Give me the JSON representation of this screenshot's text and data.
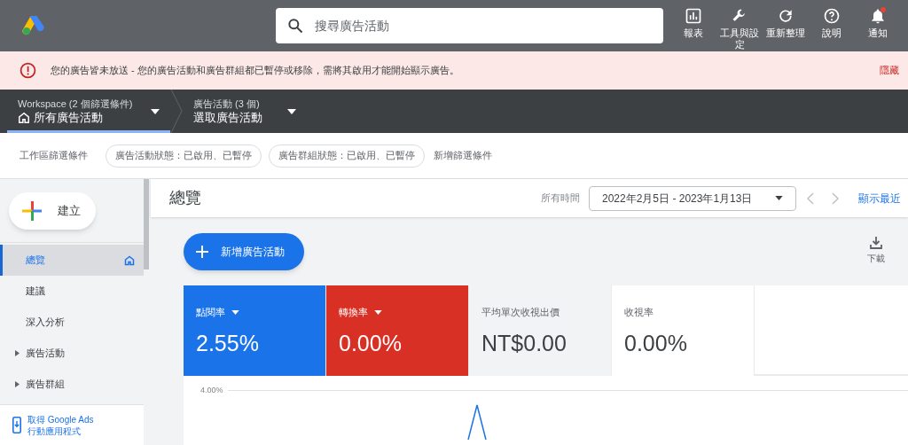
{
  "top_bar": {
    "search": {
      "placeholder": "搜尋廣告活動"
    },
    "actions": [
      {
        "kind": "reports",
        "label": "報表",
        "badge": false
      },
      {
        "kind": "tools",
        "label": "工具與設定",
        "badge": false
      },
      {
        "kind": "refresh",
        "label": "重新整理",
        "badge": false
      },
      {
        "kind": "help",
        "label": "說明",
        "badge": false
      },
      {
        "kind": "notifications",
        "label": "通知",
        "badge": true
      }
    ]
  },
  "alert": {
    "message": "您的廣告皆未放送 - 您的廣告活動和廣告群組都已暫停或移除，需將其啟用才能開始顯示廣告。",
    "action": "隱藏"
  },
  "breadcrumbs": [
    {
      "caption": "Workspace (2 個篩選條件)",
      "value": "所有廣告活動",
      "home": true,
      "selected": true
    },
    {
      "caption": "廣告活動 (3 個)",
      "value": "選取廣告活動",
      "home": false,
      "selected": false
    }
  ],
  "filters": {
    "label": "工作區篩選條件",
    "chips": [
      "廣告活動狀態：已啟用、已暫停",
      "廣告群組狀態：已啟用、已暫停"
    ],
    "add": "新增篩選條件"
  },
  "sidebar": {
    "create": "建立",
    "items": [
      {
        "label": "總覽",
        "selected": true,
        "expandable": false,
        "home": true
      },
      {
        "label": "建議",
        "selected": false,
        "expandable": false,
        "home": false
      },
      {
        "label": "深入分析",
        "selected": false,
        "expandable": false,
        "home": false
      },
      {
        "label": "廣告活動",
        "selected": false,
        "expandable": true,
        "home": false
      },
      {
        "label": "廣告群組",
        "selected": false,
        "expandable": true,
        "home": false
      }
    ],
    "app_link": [
      "取得 Google Ads",
      "行動應用程式"
    ]
  },
  "header": {
    "title": "總覽",
    "range_label": "所有時間",
    "date_range": "2022年2月5日 - 2023年1月13日",
    "show_recent": "顯示最近"
  },
  "new_campaign": "新增廣告活動",
  "download": "下載",
  "metrics": [
    {
      "label": "點閱率",
      "value": "2.55%",
      "selected": true,
      "color": "#1a73e8"
    },
    {
      "label": "轉換率",
      "value": "0.00%",
      "selected": true,
      "color": "#d93025"
    },
    {
      "label": "平均單次收視出價",
      "value": "NT$0.00",
      "selected": false,
      "color": "#f1f3f4"
    },
    {
      "label": "收視率",
      "value": "0.00%",
      "selected": false,
      "color": "#ffffff"
    }
  ],
  "chart": {
    "y_tick": "4.00%"
  }
}
